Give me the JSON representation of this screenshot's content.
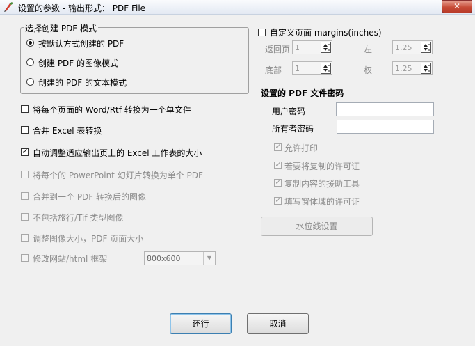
{
  "window": {
    "title": "设置的参数 - 输出形式： PDF File",
    "close": "✕"
  },
  "mode_group": {
    "label": "选择创建 PDF 模式",
    "options": [
      "按默认方式创建的 PDF",
      "创建 PDF 的图像模式",
      "创建的 PDF 的文本模式"
    ],
    "selected": 0
  },
  "options": {
    "convert_word_rtf": "将每个页面的 Word/Rtf 转换为一个单文件",
    "merge_excel": "合并 Excel 表转换",
    "auto_fit_excel": "自动调整适应输出页上的 Excel 工作表的大小",
    "ppt_slides": "将每个的 PowerPoint 幻灯片转换为单个 PDF",
    "merge_images": "合并到一个 PDF 转换后的图像",
    "no_tif": "不包括旅行/Tif 类型图像",
    "resize_image": "调整图像大小，PDF 页面大小",
    "html_frame": "修改网站/html 框架",
    "frame_size": "800x600"
  },
  "margins": {
    "label": "自定义页面 margins(inches)",
    "top_label": "返回页",
    "top_value": "1",
    "left_label": "左",
    "left_value": "1.25",
    "bottom_label": "底部",
    "bottom_value": "1",
    "right_label": "权",
    "right_value": "1.25"
  },
  "security": {
    "title": "设置的 PDF 文件密码",
    "user_pw_label": "用户密码",
    "owner_pw_label": "所有者密码",
    "allow_print": "允许打印",
    "allow_copy": "若要将复制的许可证",
    "copy_tools": "复制内容的援助工具",
    "fill_forms": "填写窗体域的许可证"
  },
  "watermark_button": "水位线设置",
  "ok_button": "还行",
  "cancel_button": "取消"
}
